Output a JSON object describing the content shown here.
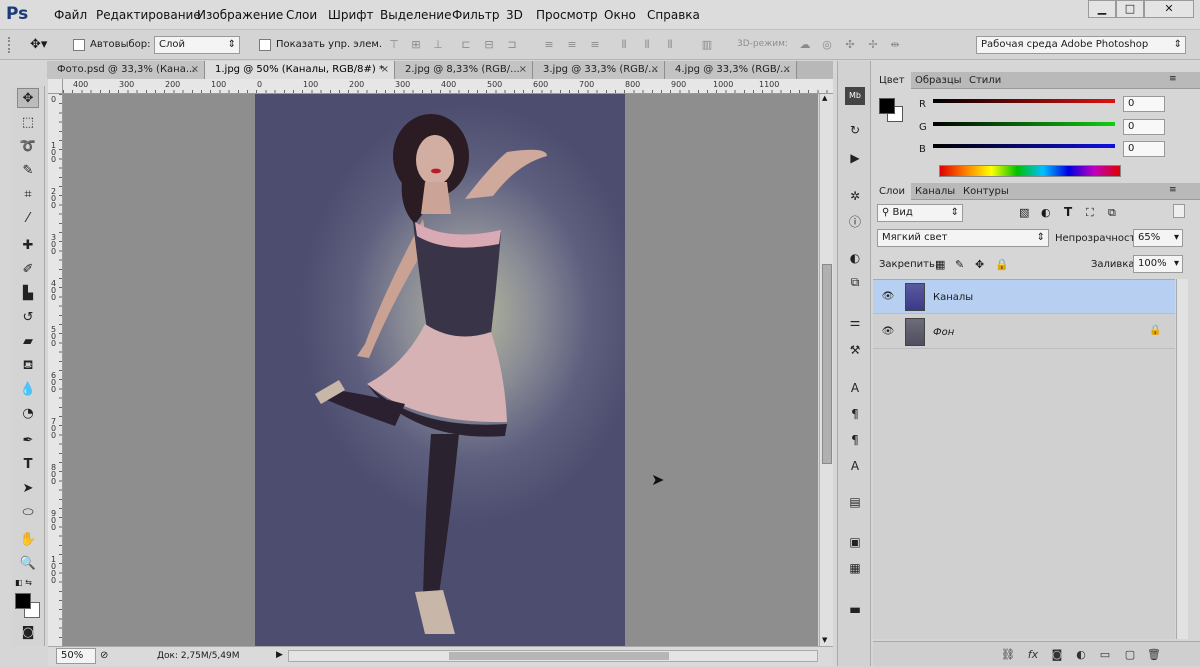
{
  "menubar": {
    "logo": "Ps",
    "items": [
      "Файл",
      "Редактирование",
      "Изображение",
      "Слои",
      "Шрифт",
      "Выделение",
      "Фильтр",
      "3D",
      "Просмотр",
      "Окно",
      "Справка"
    ],
    "window_buttons": [
      "▁",
      "□",
      "✕"
    ]
  },
  "options": {
    "autoselect_label": "Автовыбор:",
    "autoselect_target": "Слой",
    "show_controls_label": "Показать упр. элем.",
    "mode_3d_label": "3D-режим:",
    "workspace": "Рабочая среда Adobe Photoshop"
  },
  "tabs": [
    {
      "label": "Фото.psd @ 33,3% (Кана..."
    },
    {
      "label": "1.jpg @ 50% (Каналы, RGB/8#) *"
    },
    {
      "label": "2.jpg @ 8,33% (RGB/..."
    },
    {
      "label": "3.jpg @ 33,3% (RGB/..."
    },
    {
      "label": "4.jpg @ 33,3% (RGB/..."
    }
  ],
  "tab_close": "×",
  "ruler": {
    "top": [
      "400",
      "300",
      "200",
      "100",
      "0",
      "100",
      "200",
      "300",
      "400",
      "500",
      "600",
      "700",
      "800",
      "900",
      "1000",
      "1100"
    ],
    "left": [
      "0",
      "1 0 0",
      "2 0 0",
      "3 0 0",
      "4 0 0",
      "5 0 0",
      "6 0 0",
      "7 0 0",
      "8 0 0",
      "9 0 0",
      "1 0 0 0"
    ]
  },
  "status": {
    "zoom": "50%",
    "doc": "Док: 2,75M/5,49M"
  },
  "color_panel": {
    "tabs": [
      "Цвет",
      "Образцы",
      "Стили"
    ],
    "channels": [
      {
        "name": "R",
        "value": "0",
        "color": "#d01010"
      },
      {
        "name": "G",
        "value": "0",
        "color": "#10c010"
      },
      {
        "name": "B",
        "value": "0",
        "color": "#1010c0"
      }
    ]
  },
  "layers_panel": {
    "tabs": [
      "Слои",
      "Каналы",
      "Контуры"
    ],
    "filter_kind": "Вид",
    "blend_mode": "Мягкий свет",
    "opacity_label": "Непрозрачность:",
    "opacity": "65%",
    "lock_label": "Закрепить:",
    "fill_label": "Заливка:",
    "fill": "100%",
    "layers": [
      {
        "name": "Каналы",
        "selected": true
      },
      {
        "name": "Фон",
        "selected": false
      }
    ]
  },
  "colors": {
    "selection": "#b7d0f2",
    "canvas_bg": "#8e8e8e"
  }
}
